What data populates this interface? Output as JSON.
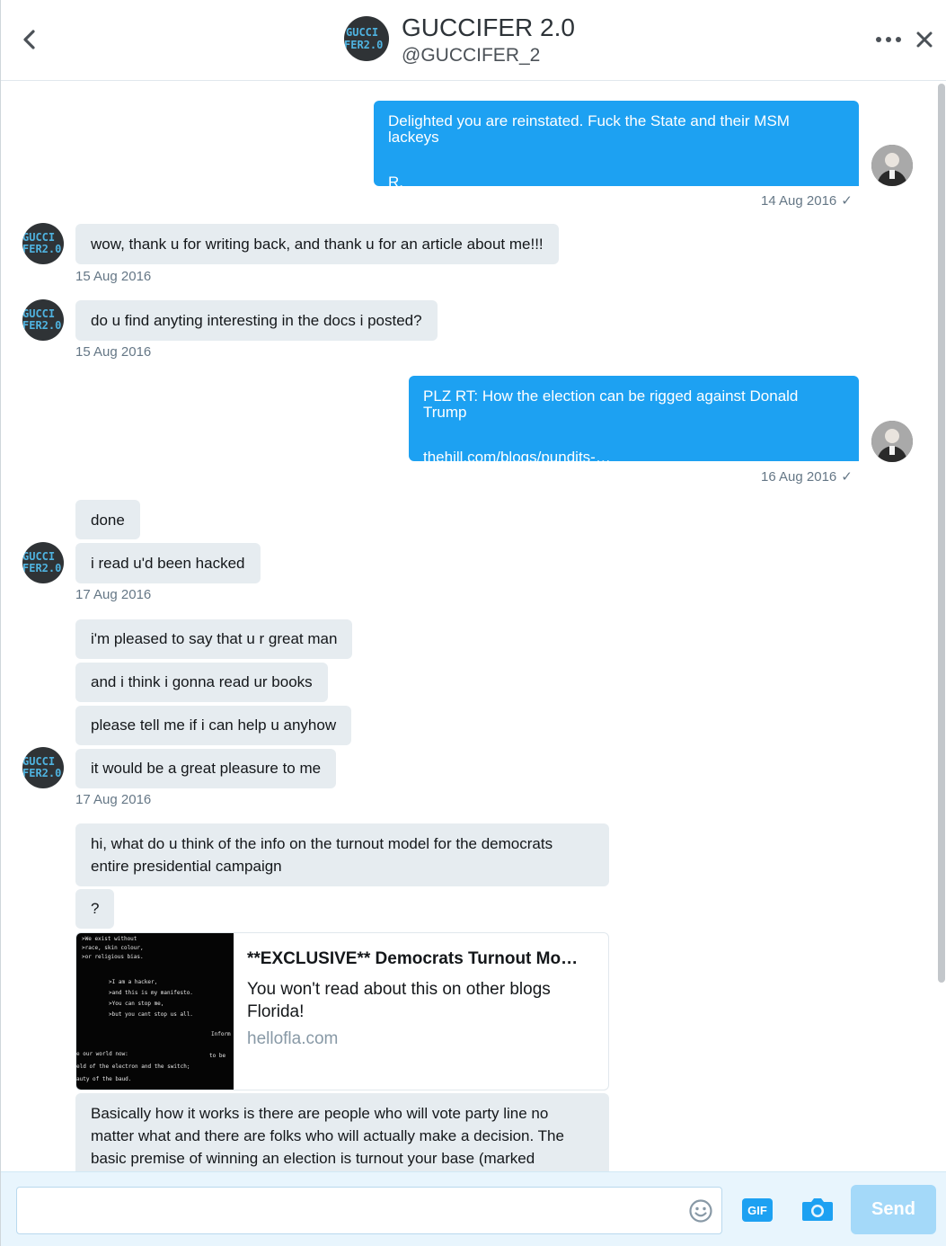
{
  "header": {
    "name": "GUCCIFER 2.0",
    "handle": "@GUCCIFER_2",
    "avatar_logo_line1": "GUCCI",
    "avatar_logo_line2": "FER2.0",
    "back_icon": "chevron-left-icon",
    "more_icon": "ellipsis-icon",
    "close_icon": "close-icon"
  },
  "messages": [
    {
      "from": "me",
      "text": "Delighted you are reinstated. Fuck the State and their MSM lackeys",
      "text2": "R.",
      "timestamp": "14 Aug 2016",
      "read": "✓"
    },
    {
      "from": "them",
      "text": "wow, thank u for writing back, and thank u for an article about me!!!",
      "timestamp": "15 Aug 2016"
    },
    {
      "from": "them",
      "text": "do u find anyting interesting in the docs i posted?",
      "timestamp": "15 Aug 2016"
    },
    {
      "from": "me",
      "text": "PLZ RT: How the election can be rigged against Donald Trump",
      "link": "thehill.com/blogs/pundits-…",
      "timestamp": "16 Aug 2016",
      "read": "✓"
    },
    {
      "from": "them",
      "text": "done"
    },
    {
      "from": "them",
      "text": "i read u'd been hacked",
      "timestamp": "17 Aug 2016"
    },
    {
      "from": "them",
      "text": "i'm pleased to say that u r great man"
    },
    {
      "from": "them",
      "text": "and i think i gonna read ur books"
    },
    {
      "from": "them",
      "text": "please tell me if i can help u anyhow"
    },
    {
      "from": "them",
      "text": "it would be a great pleasure to me",
      "timestamp": "17 Aug 2016"
    },
    {
      "from": "them",
      "text": "hi, what do u think of the info on the turnout model for the democrats entire presidential campaign"
    },
    {
      "from": "them",
      "text": "?"
    },
    {
      "from": "them",
      "text": "Basically how it works is there are people who will vote party line no matter what and there are folks who will actually make a decision.  The basic premise of winning an election is turnout your base (marked"
    }
  ],
  "link_card": {
    "title": "**EXCLUSIVE** Democrats Turnout Mo…",
    "description": "You won't read about this on other blogs Florida!",
    "domain": "hellofla.com",
    "image_lines": [
      ">We exist without",
      ">race, skin colour,",
      ">or religious bias.",
      ">I am a hacker,",
      ">and this is my manifesto.",
      ">You can stop me,",
      ">but you cant stop us all.",
      "Inform",
      "e our world now:",
      "to be",
      "eld of the electron and the switch;",
      "auty of the baud."
    ]
  },
  "composer": {
    "placeholder": "",
    "gif_label": "GIF",
    "send_label": "Send",
    "emoji_icon": "emoji-icon",
    "camera_icon": "camera-icon"
  },
  "colors": {
    "accent": "#1da1f2",
    "incoming_bubble": "#e6ecf0",
    "send_disabled": "#a4d9f9",
    "logo": "#4fb3e0"
  }
}
